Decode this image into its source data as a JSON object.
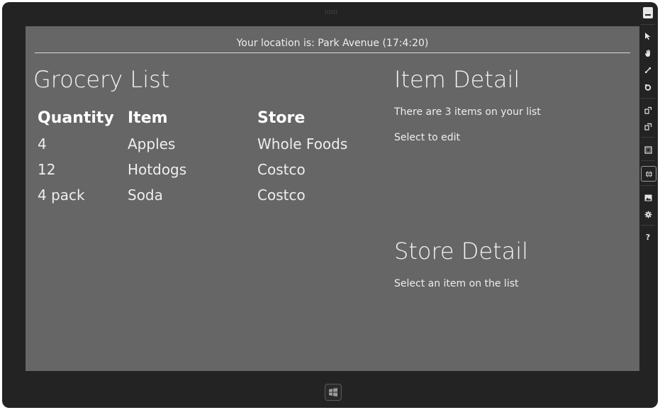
{
  "location_text": "Your location is: Park Avenue (17:4:20)",
  "grocery": {
    "title": "Grocery List",
    "columns": [
      "Quantity",
      "Item",
      "Store"
    ],
    "rows": [
      {
        "quantity": "4",
        "item": "Apples",
        "store": "Whole Foods"
      },
      {
        "quantity": "12",
        "item": "Hotdogs",
        "store": "Costco"
      },
      {
        "quantity": "4 pack",
        "item": "Soda",
        "store": "Costco"
      }
    ]
  },
  "item_detail": {
    "title": "Item Detail",
    "count_text": "There are 3 items on your list",
    "hint_text": "Select to edit"
  },
  "store_detail": {
    "title": "Store Detail",
    "hint_text": "Select an item on the list"
  },
  "toolbar": {
    "icons": [
      "minimize-icon",
      "pointer-icon",
      "hand-icon",
      "resize-icon",
      "rotate-icon",
      "rotate-left-icon",
      "rotate-right-icon",
      "screen-resolution-icon",
      "location-icon",
      "screenshot-icon",
      "settings-icon",
      "help-icon"
    ],
    "help_glyph": "?"
  },
  "colors": {
    "screen_bg": "#666666",
    "frame_bg": "#232323",
    "text": "#f2f2f2"
  }
}
